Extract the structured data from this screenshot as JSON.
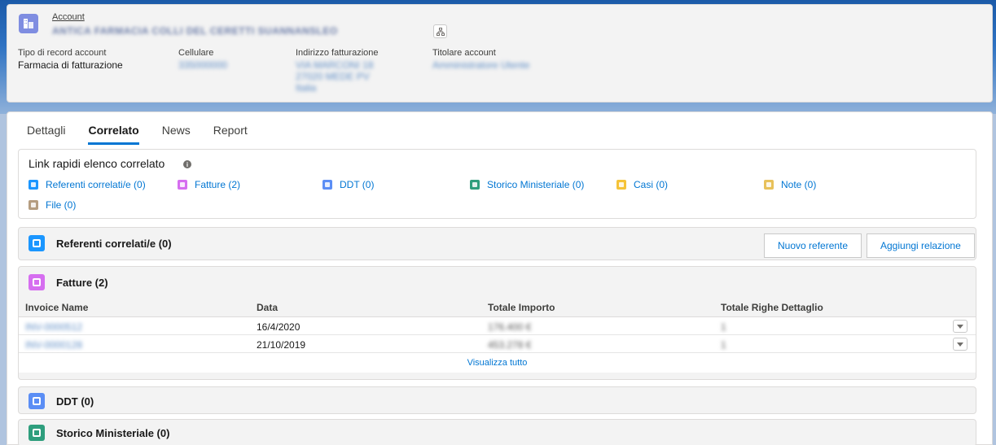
{
  "colors": {
    "accent": "#0176d3",
    "account_icon": "#7f8de1",
    "referenti_icon": "#1b96ff",
    "fatture_icon": "#d66ef0",
    "ddt_icon": "#5b8ef5",
    "storico_icon": "#2e9e7d",
    "casi_icon": "#f5c338",
    "note_icon": "#e8c15a",
    "file_icon": "#b59d80"
  },
  "header": {
    "entity_label": "Account",
    "account_name": "ANTICA FARMACIA COLLI DEL CERETTI SUANNANSLEO",
    "hierarchy_icon": "hierarchy-icon",
    "fields": [
      {
        "label": "Tipo di record account",
        "value": "Farmacia di fatturazione"
      },
      {
        "label": "Cellulare",
        "value": "335000000"
      },
      {
        "label": "Indirizzo fatturazione",
        "lines": [
          "VIA MARCONI 18",
          "27020 MEDE PV",
          "Italia"
        ]
      },
      {
        "label": "Titolare account",
        "value": "Amministratore Utente"
      }
    ]
  },
  "tabs": [
    {
      "label": "Dettagli",
      "active": false
    },
    {
      "label": "Correlato",
      "active": true
    },
    {
      "label": "News",
      "active": false
    },
    {
      "label": "Report",
      "active": false
    }
  ],
  "quick_links": {
    "title": "Link rapidi elenco correlato",
    "items": [
      {
        "label": "Referenti correlati/e (0)",
        "icon": "contacts-icon"
      },
      {
        "label": "Fatture (2)",
        "icon": "invoice-icon"
      },
      {
        "label": "DDT (0)",
        "icon": "ddt-icon"
      },
      {
        "label": "Storico Ministeriale (0)",
        "icon": "history-icon"
      },
      {
        "label": "Casi (0)",
        "icon": "case-icon"
      },
      {
        "label": "Note (0)",
        "icon": "note-icon"
      },
      {
        "label": "File (0)",
        "icon": "file-icon"
      }
    ]
  },
  "referenti": {
    "title": "Referenti correlati/e (0)",
    "new_button": "Nuovo referente",
    "add_button": "Aggiungi relazione"
  },
  "fatture": {
    "title": "Fatture (2)",
    "columns": [
      "Invoice Name",
      "Data",
      "Totale Importo",
      "Totale Righe Dettaglio"
    ],
    "rows": [
      {
        "name": "INV-0000512",
        "date": "16/4/2020",
        "total": "176.400 €",
        "lines": "1"
      },
      {
        "name": "INV-0000128",
        "date": "21/10/2019",
        "total": "453.278 €",
        "lines": "1"
      }
    ],
    "view_all": "Visualizza tutto"
  },
  "ddt": {
    "title": "DDT (0)"
  },
  "storico": {
    "title": "Storico Ministeriale (0)"
  }
}
